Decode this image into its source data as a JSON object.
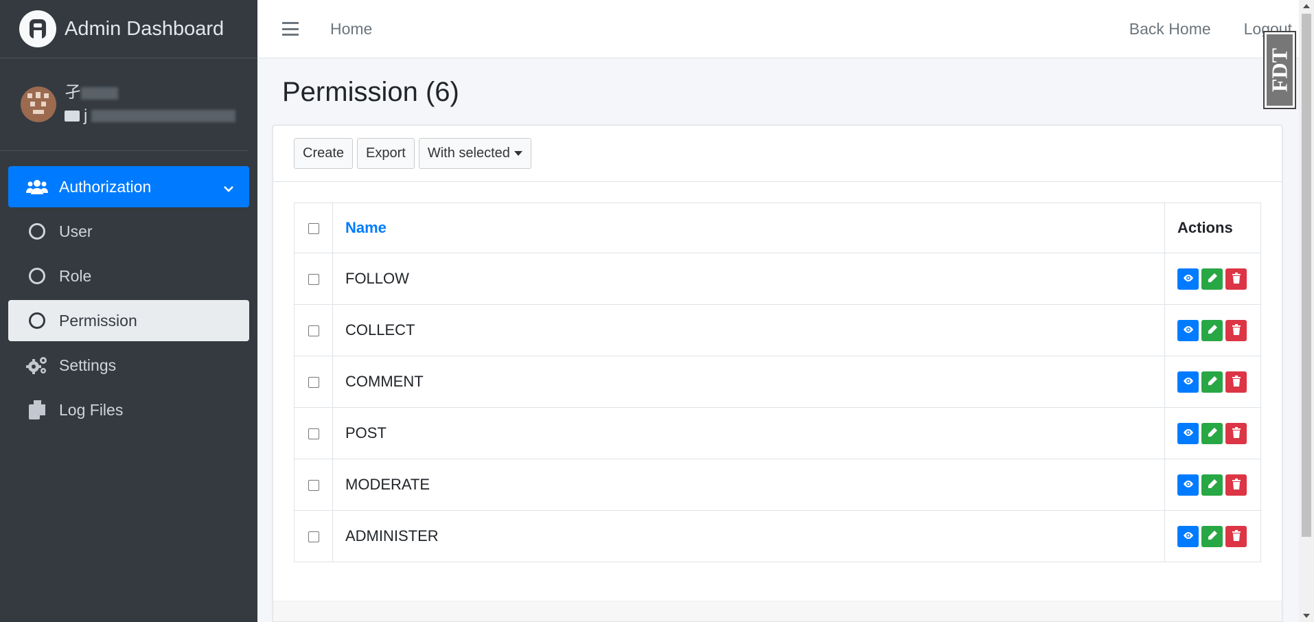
{
  "brand": {
    "title": "Admin Dashboard"
  },
  "user": {
    "name": "孑",
    "email": "j"
  },
  "sidebar": {
    "items": [
      {
        "label": "Authorization",
        "icon": "users-icon"
      },
      {
        "label": "User",
        "icon": "circle-icon"
      },
      {
        "label": "Role",
        "icon": "circle-icon"
      },
      {
        "label": "Permission",
        "icon": "circle-icon"
      },
      {
        "label": "Settings",
        "icon": "cogs-icon"
      },
      {
        "label": "Log Files",
        "icon": "copy-icon"
      }
    ]
  },
  "topbar": {
    "home": "Home",
    "back_home": "Back Home",
    "logout": "Logout"
  },
  "page": {
    "title": "Permission (6)"
  },
  "toolbar": {
    "create": "Create",
    "export": "Export",
    "with_selected": "With selected"
  },
  "table": {
    "headers": {
      "name": "Name",
      "actions": "Actions"
    },
    "rows": [
      {
        "name": "FOLLOW"
      },
      {
        "name": "COLLECT"
      },
      {
        "name": "COMMENT"
      },
      {
        "name": "POST"
      },
      {
        "name": "MODERATE"
      },
      {
        "name": "ADMINISTER"
      }
    ]
  },
  "badge": {
    "text": "FDT"
  },
  "colors": {
    "primary": "#007bff",
    "success": "#28a745",
    "danger": "#dc3545",
    "sidebar": "#343a40"
  }
}
